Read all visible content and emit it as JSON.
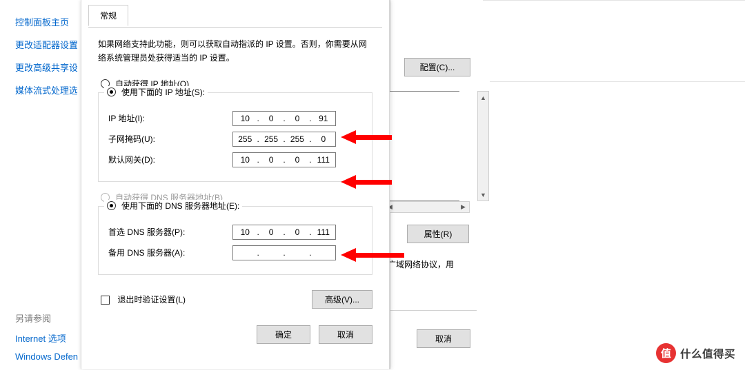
{
  "cp_links": {
    "home": "控制面板主页",
    "adapters": "更改适配器设置",
    "sharing": "更改高级共享设置",
    "streaming": "媒体流式处理选项"
  },
  "see_also": {
    "heading": "另请参阅",
    "internet": "Internet 选项",
    "defender": "Windows Defen"
  },
  "back_dialog": {
    "configure_btn": "配置(C)...",
    "properties_btn": "属性(R)",
    "desc_fragment": "广域网络协议，用",
    "cancel_btn": "取消"
  },
  "ipv4_dialog": {
    "tab_general": "常规",
    "intro": "如果网络支持此功能，则可以获取自动指派的 IP 设置。否则，你需要从网络系统管理员处获得适当的 IP 设置。",
    "radio_obtain_ip": "自动获得 IP 地址(O)",
    "radio_use_ip": "使用下面的 IP 地址(S):",
    "label_ip": "IP 地址(I):",
    "label_subnet": "子网掩码(U):",
    "label_gateway": "默认网关(D):",
    "ip_addr": {
      "a": "10",
      "b": "0",
      "c": "0",
      "d": "91"
    },
    "subnet": {
      "a": "255",
      "b": "255",
      "c": "255",
      "d": "0"
    },
    "gateway": {
      "a": "10",
      "b": "0",
      "c": "0",
      "d": "111"
    },
    "radio_obtain_dns": "自动获得 DNS 服务器地址(B)",
    "radio_use_dns": "使用下面的 DNS 服务器地址(E):",
    "label_dns_pref": "首选 DNS 服务器(P):",
    "label_dns_alt": "备用 DNS 服务器(A):",
    "dns_pref": {
      "a": "10",
      "b": "0",
      "c": "0",
      "d": "111"
    },
    "dns_alt": {
      "a": "",
      "b": "",
      "c": "",
      "d": ""
    },
    "validate_checkbox": "退出时验证设置(L)",
    "advanced_btn": "高级(V)...",
    "ok_btn": "确定",
    "cancel_btn": "取消"
  },
  "watermark_text": "什么值得买",
  "watermark_badge": "值"
}
